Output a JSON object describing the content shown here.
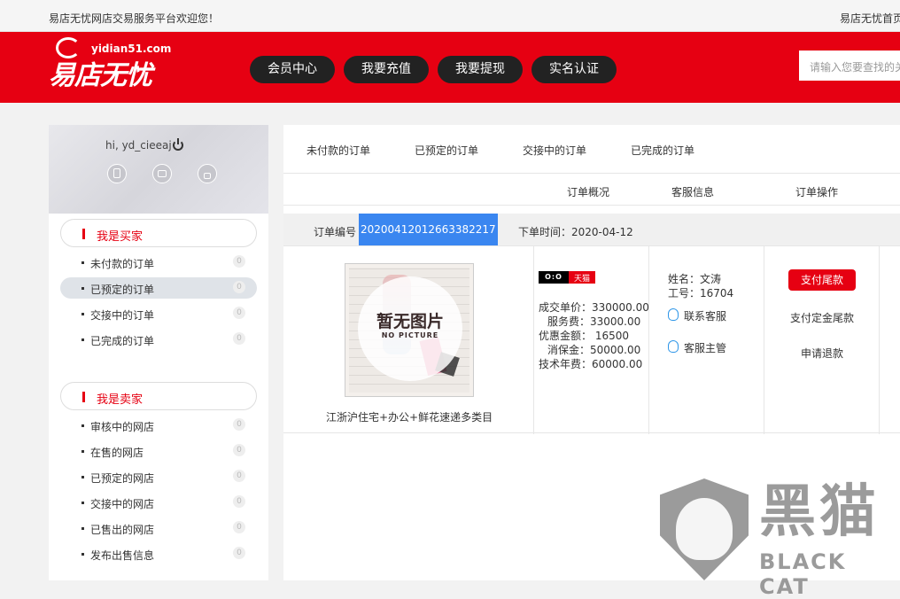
{
  "topbar": {
    "welcome": "易店无忧网店交易服务平台欢迎您！",
    "home_link": "易店无忧首页"
  },
  "header": {
    "logo_site": "yidian51.com",
    "logo_name": "易店无忧",
    "nav": [
      "会员中心",
      "我要充值",
      "我要提现",
      "实名认证"
    ],
    "search_placeholder": "请输入您要查找的关键词"
  },
  "sidebar": {
    "greeting": "hi, yd_cieeaj",
    "buyer": {
      "title": "我是买家",
      "items": [
        {
          "label": "未付款的订单",
          "count": "0"
        },
        {
          "label": "已预定的订单",
          "count": "0"
        },
        {
          "label": "交接中的订单",
          "count": "0"
        },
        {
          "label": "已完成的订单",
          "count": "0"
        }
      ]
    },
    "seller": {
      "title": "我是卖家",
      "items": [
        {
          "label": "审核中的网店",
          "count": "0"
        },
        {
          "label": "在售的网店",
          "count": "0"
        },
        {
          "label": "已预定的网店",
          "count": "0"
        },
        {
          "label": "交接中的网店",
          "count": "0"
        },
        {
          "label": "已售出的网店",
          "count": "0"
        },
        {
          "label": "发布出售信息",
          "count": "0"
        }
      ]
    }
  },
  "main": {
    "tabs": [
      "未付款的订单",
      "已预定的订单",
      "交接中的订单",
      "已完成的订单"
    ],
    "columns": [
      "订单概况",
      "客服信息",
      "订单操作"
    ],
    "order": {
      "number_label": "订单编号",
      "number": "20200412012663382217",
      "time_label": "下单时间：2020-04-12",
      "image_text": "暂无图片",
      "image_subtext": "NO PICTURE",
      "product_name": "江浙沪住宅+办公+鲜花速递多类目",
      "platform": "天猫",
      "platform_face": "O:O",
      "prices": [
        "成交单价：330000.00",
        "服务费：33000.00",
        "优惠金额： 16500",
        "消保金：50000.00",
        "技术年费：60000.00"
      ],
      "service": {
        "name": "姓名：文涛",
        "id": "工号：16704",
        "contact": "联系客服",
        "manager": "客服主管"
      },
      "actions": {
        "pay_balance": "支付尾款",
        "pay_deposit": "支付定金尾款",
        "refund": "申请退款"
      }
    }
  },
  "watermark": {
    "big": "黑猫",
    "small": "BLACK CAT"
  }
}
